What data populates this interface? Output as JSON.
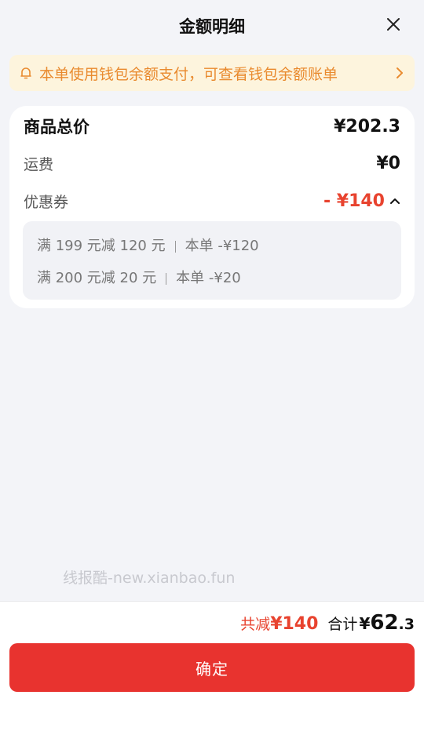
{
  "header": {
    "title": "金额明细",
    "close_icon": "close-icon"
  },
  "notice": {
    "text": "本单使用钱包余额支付，可查看钱包余额账单",
    "icon": "bell-icon",
    "color": "#e98a2e"
  },
  "breakdown": {
    "goods_total_label": "商品总价",
    "goods_total_value": "¥202.3",
    "shipping_label": "运费",
    "shipping_value": "¥0",
    "coupon_label": "优惠券",
    "coupon_value": "- ¥140",
    "coupons": [
      {
        "rule": "满 199 元减 120 元",
        "applied": "本单 -¥120"
      },
      {
        "rule": "满 200 元减 20 元",
        "applied": "本单 -¥20"
      }
    ]
  },
  "watermark": "线报酷-new.xianbao.fun",
  "footer": {
    "saved_label": "共减",
    "saved_amount": "¥140",
    "total_label": "合计",
    "total_yen": "¥",
    "total_int": "62",
    "total_dec": ".3",
    "confirm_label": "确定"
  },
  "colors": {
    "accent_red": "#e8332f",
    "background": "#f3f4f8"
  }
}
